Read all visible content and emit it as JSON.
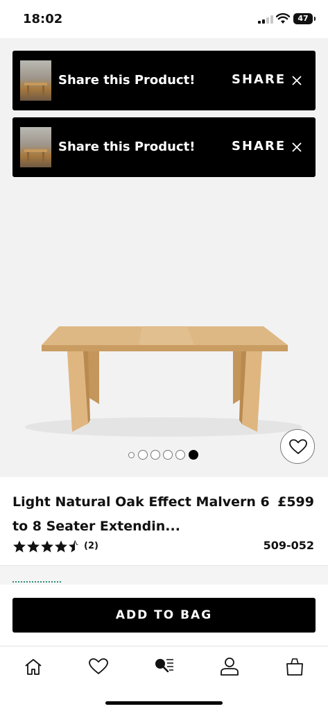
{
  "status_bar": {
    "time": "18:02",
    "battery": "47"
  },
  "share_banners": [
    {
      "title": "Share this Product!",
      "action": "SHARE"
    },
    {
      "title": "Share this Product!",
      "action": "SHARE"
    }
  ],
  "gallery": {
    "image_count": 6,
    "active_index": 5
  },
  "product": {
    "name": "Light Natural Oak Effect Malvern 6 to 8 Seater Extendin...",
    "price": "£599",
    "rating": 4.5,
    "review_count": "(2)",
    "code": "509-052"
  },
  "cta": {
    "add_to_bag": "ADD TO BAG"
  },
  "tab_bar": [
    "home-icon",
    "heart-icon",
    "search-list-icon",
    "account-icon",
    "bag-icon"
  ],
  "colors": {
    "black": "#000000",
    "hero_bg": "#f2f2f2",
    "oak": "#d9b07a"
  }
}
